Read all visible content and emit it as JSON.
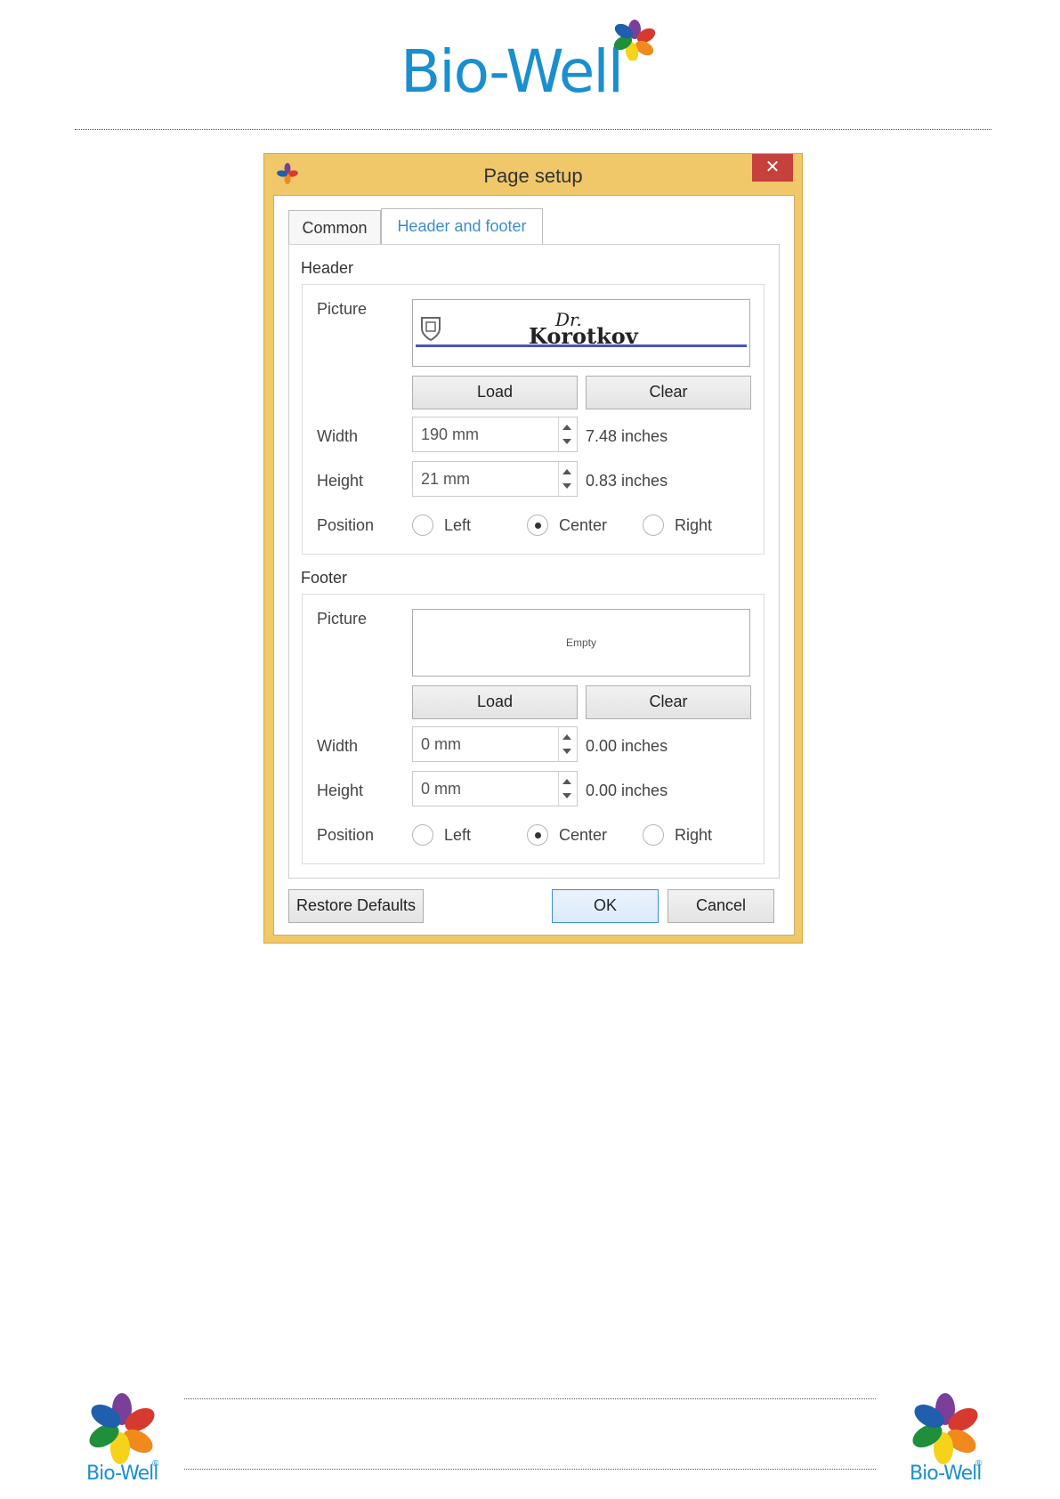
{
  "brand": {
    "name": "Bio-Well",
    "registered_mark": "®"
  },
  "dialog": {
    "title": "Page setup",
    "close_glyph": "✕",
    "tabs": [
      {
        "label": "Common",
        "active": false
      },
      {
        "label": "Header and footer",
        "active": true
      }
    ],
    "header": {
      "section_title": "Header",
      "picture_label": "Picture",
      "picture_logo_text": "Korotkov",
      "picture_logo_prefix": "Dr.",
      "load_label": "Load",
      "clear_label": "Clear",
      "width_label": "Width",
      "width_value": "190 mm",
      "width_inches": "7.48 inches",
      "height_label": "Height",
      "height_value": "21 mm",
      "height_inches": "0.83 inches",
      "position_label": "Position",
      "position_options": [
        "Left",
        "Center",
        "Right"
      ],
      "position_selected": "Center"
    },
    "footer": {
      "section_title": "Footer",
      "picture_label": "Picture",
      "picture_empty_text": "Empty",
      "load_label": "Load",
      "clear_label": "Clear",
      "width_label": "Width",
      "width_value": "0 mm",
      "width_inches": "0.00 inches",
      "height_label": "Height",
      "height_value": "0 mm",
      "height_inches": "0.00 inches",
      "position_label": "Position",
      "position_options": [
        "Left",
        "Center",
        "Right"
      ],
      "position_selected": "Center"
    },
    "buttons": {
      "restore_defaults": "Restore Defaults",
      "ok": "OK",
      "cancel": "Cancel"
    }
  },
  "colors": {
    "titlebar": "#f0c86a",
    "close": "#c7413c",
    "active_tab_text": "#3d8ec9",
    "brand_blue": "#1a8fd0"
  }
}
